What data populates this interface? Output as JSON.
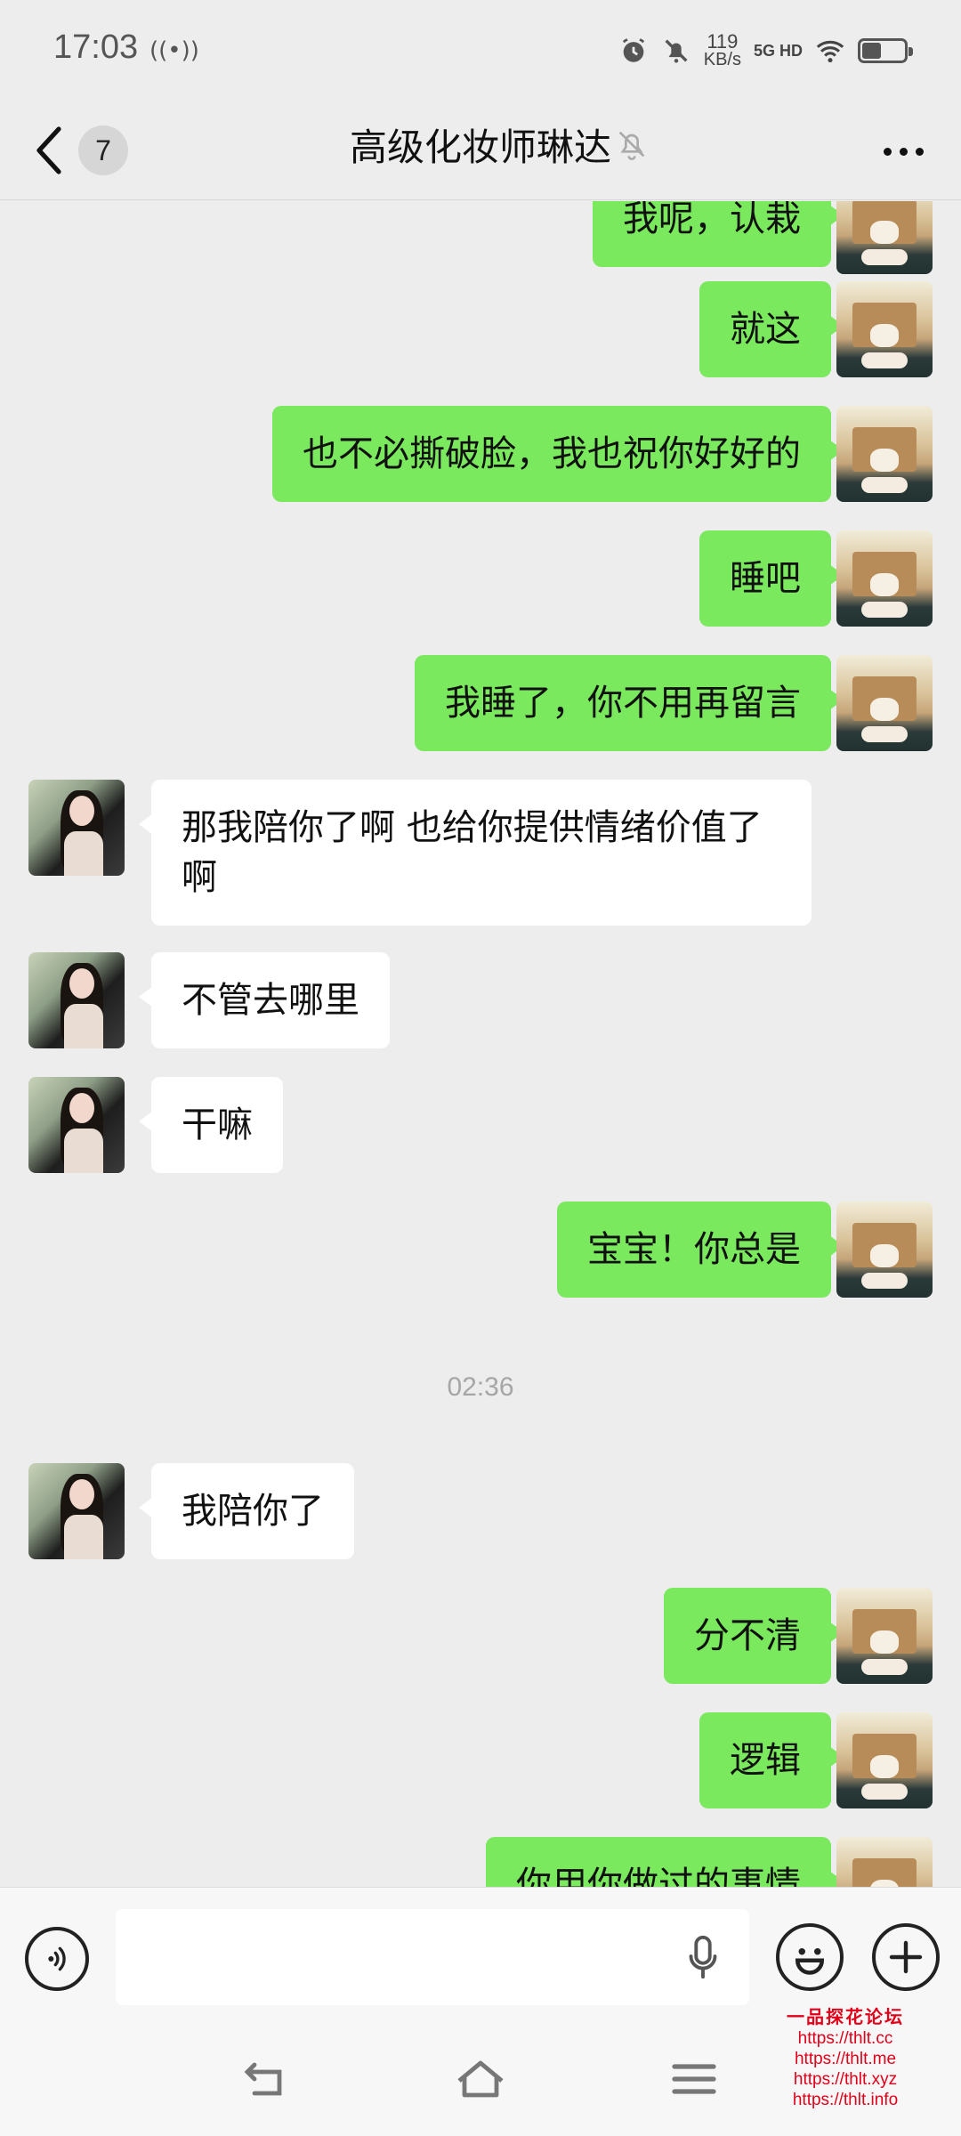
{
  "status_bar": {
    "time": "17:03",
    "speed_value": "119",
    "speed_unit": "KB/s",
    "network": "5G HD",
    "battery_level_percent": 45
  },
  "header": {
    "back_count": "7",
    "title": "高级化妆师琳达"
  },
  "messages": [
    {
      "side": "self",
      "text": "我呢，认栽"
    },
    {
      "side": "self",
      "text": "就这"
    },
    {
      "side": "self",
      "text": "也不必撕破脸，我也祝你好好的"
    },
    {
      "side": "self",
      "text": "睡吧"
    },
    {
      "side": "self",
      "text": "我睡了，你不用再留言"
    },
    {
      "side": "other",
      "text": "那我陪你了啊 也给你提供情绪价值了啊"
    },
    {
      "side": "other",
      "text": "不管去哪里"
    },
    {
      "side": "other",
      "text": "干嘛"
    },
    {
      "side": "self",
      "text": "宝宝！你总是"
    },
    {
      "side": "other",
      "text": "我陪你了"
    },
    {
      "side": "self",
      "text": "分不清"
    },
    {
      "side": "self",
      "text": "逻辑"
    },
    {
      "side": "self",
      "text": "你用你做过的事情"
    }
  ],
  "timestamp": "02:36",
  "input": {
    "value": "",
    "placeholder": ""
  },
  "watermark": {
    "title": "一品探花论坛",
    "links": [
      "https://thlt.cc",
      "https://thlt.me",
      "https://thlt.xyz",
      "https://thlt.info"
    ]
  },
  "colors": {
    "self_bubble": "#7ae95e",
    "other_bubble": "#ffffff",
    "background": "#ededed",
    "watermark": "#e0001a"
  },
  "icons": [
    "back-chevron-icon",
    "mute-bell-icon",
    "more-icon",
    "voice-icon",
    "mic-icon",
    "emoji-icon",
    "plus-icon",
    "nav-back-icon",
    "nav-home-icon",
    "nav-menu-icon"
  ]
}
